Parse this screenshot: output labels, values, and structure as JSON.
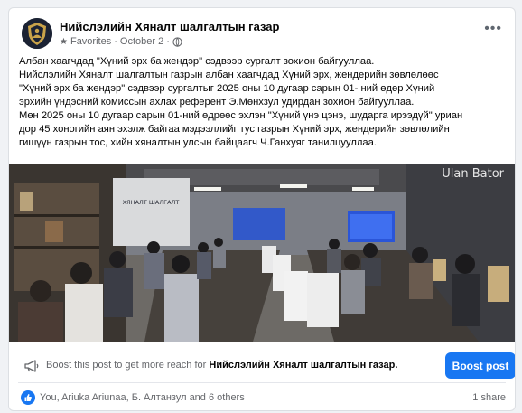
{
  "post": {
    "page_name": "Нийслэлийн Хяналт шалгалтын газар",
    "audience": "Favorites",
    "date": "October 2",
    "text_lines": [
      "Албан хаагчдад \"Хүний эрх ба жендэр\" сэдвээр сургалт зохион байгууллаа.",
      "Нийслэлийн Хяналт шалгалтын газрын албан хаагчдад Хүний эрх, жендерийн зөвлөлөөс",
      "\"Хүний эрх ба жендэр\" сэдвээр сургалтыг 2025 оны 10 дугаар сарын 01- ний өдөр Хүний",
      "эрхийн үндэсний комиссын ахлах референт Э.Мөнхзул удирдан зохион байгууллаа.",
      "Мөн 2025 оны 10 дугаар сарын 01-ний өдрөөс эхлэн \"Хүний үнэ цэнэ, шударга ирээдүй\" уриан",
      "дор 45 хоногийн аян эхэлж байгаа мэдээллийг тус газрын Хүний эрх, жендерийн зөвлөлийн",
      "гишүүн газрын тос, хийн хяналтын улсын байцаагч Ч.Ганхуяг танилцууллаа."
    ],
    "photo_watermark": "Ulan Bator",
    "photo_sign": "ХЯНАЛТ ШАЛГАЛТ"
  },
  "boost": {
    "prompt": "Boost this post to get more reach for",
    "page_name": "Нийслэлийн Хяналт шалгалтын газар.",
    "button_label": "Boost post"
  },
  "engagement": {
    "reactors": "You, Ariuka Ariunaa, Б. Алтанзул and 6 others",
    "shares": "1 share"
  },
  "colors": {
    "accent": "#1877f2",
    "secondary_text": "#65676b"
  },
  "icons": [
    "page-logo",
    "star-icon",
    "globe-icon",
    "more-icon",
    "megaphone-icon",
    "like-icon"
  ]
}
